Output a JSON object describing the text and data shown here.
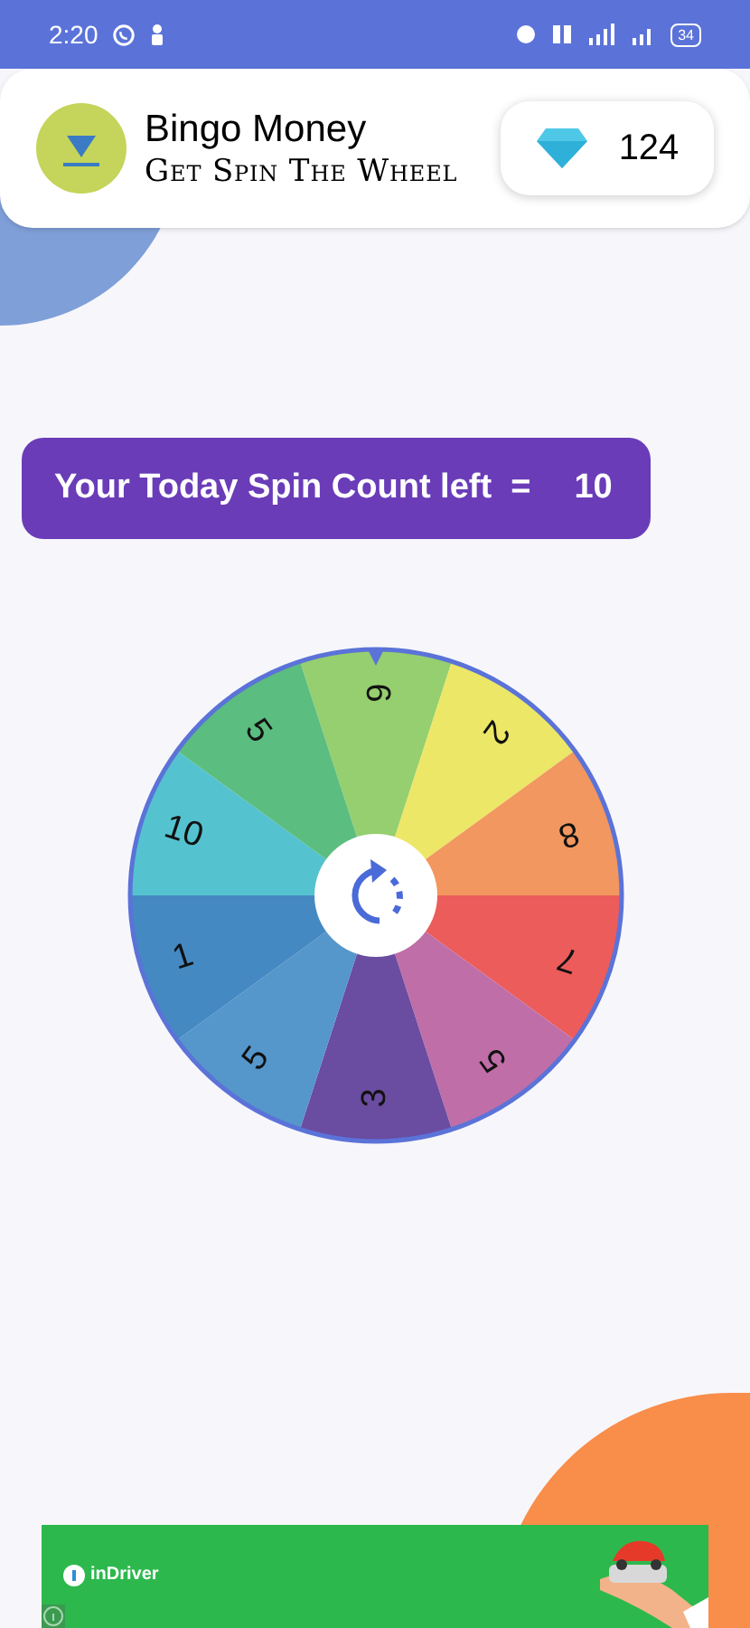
{
  "status_bar": {
    "time": "2:20",
    "battery": "34"
  },
  "header": {
    "title": "Bingo Money",
    "subtitle": "Get Spin The Wheel",
    "gems": "124"
  },
  "spin_banner": {
    "label": "Your Today Spin Count left  =",
    "count": "10"
  },
  "wheel": {
    "segments": [
      {
        "label": "6",
        "color": "#95cf6f"
      },
      {
        "label": "2",
        "color": "#ece766"
      },
      {
        "label": "8",
        "color": "#f2975f"
      },
      {
        "label": "7",
        "color": "#ec5c5a"
      },
      {
        "label": "5",
        "color": "#c06ea8"
      },
      {
        "label": "3",
        "color": "#6a4ca0"
      },
      {
        "label": "5",
        "color": "#5596cb"
      },
      {
        "label": "1",
        "color": "#4489c2"
      },
      {
        "label": "10",
        "color": "#55c2cf"
      },
      {
        "label": "5",
        "color": "#5bbd7f"
      }
    ]
  },
  "ad": {
    "brand": "inDriver"
  }
}
